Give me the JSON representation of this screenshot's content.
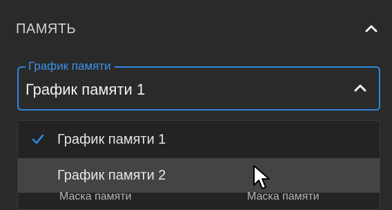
{
  "section": {
    "title": "ПАМЯТЬ",
    "toggle_icon": "chevron-up-icon"
  },
  "select": {
    "legend": "График памяти",
    "value": "График памяти 1",
    "toggle_icon": "chevron-up-icon",
    "accent_color": "#2f86dc"
  },
  "menu": {
    "items": [
      {
        "label": "График памяти 1",
        "selected": true,
        "icon": "checkmark-icon"
      },
      {
        "label": "График памяти 2",
        "selected": false,
        "hovered": true
      }
    ]
  },
  "footer": {
    "left_label": "Маска памяти",
    "right_label": "Маска памяти"
  },
  "colors": {
    "background": "#2a2a2a",
    "menu_background": "#232323",
    "hover_background": "#444444",
    "accent": "#2f86dc"
  }
}
